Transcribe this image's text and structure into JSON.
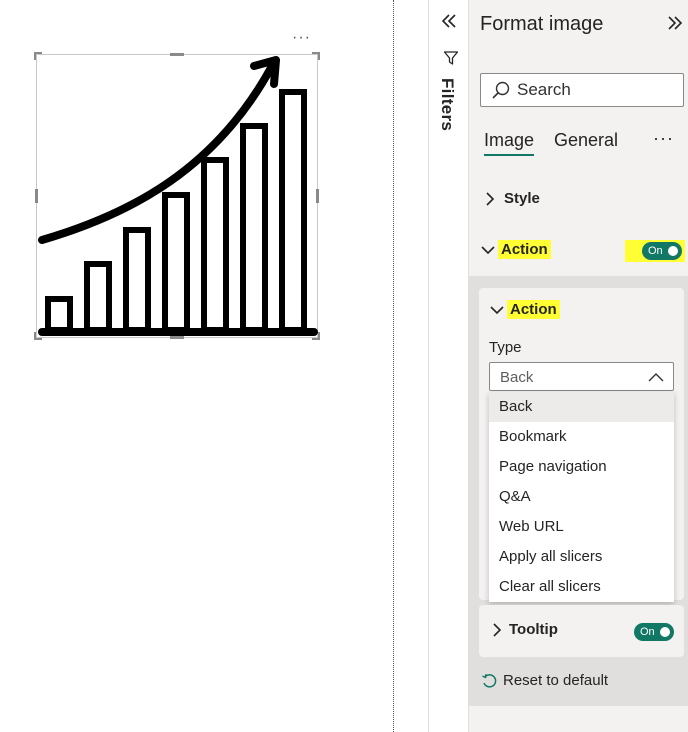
{
  "canvas": {
    "visual_more_label": "···"
  },
  "filters": {
    "label": "Filters"
  },
  "format_pane": {
    "title": "Format image",
    "search": {
      "placeholder": "Search",
      "value": ""
    },
    "tabs": [
      {
        "label": "Image",
        "active": true
      },
      {
        "label": "General",
        "active": false
      }
    ],
    "tabs_more_label": "···",
    "sections": {
      "style": {
        "label": "Style",
        "expanded": false
      },
      "action": {
        "label": "Action",
        "expanded": true,
        "toggle": {
          "label": "On",
          "on": true
        },
        "inner": {
          "label": "Action",
          "type_label": "Type",
          "type_value": "Back",
          "dropdown_open": true,
          "options": [
            "Back",
            "Bookmark",
            "Page navigation",
            "Q&A",
            "Web URL",
            "Apply all slicers",
            "Clear all slicers"
          ],
          "selected_option": "Back"
        }
      },
      "tooltip": {
        "label": "Tooltip",
        "expanded": false,
        "toggle": {
          "label": "On",
          "on": true
        }
      }
    },
    "reset_label": "Reset to default"
  },
  "colors": {
    "accent": "#117865",
    "highlight": "#ffff33",
    "pane_background": "#f3f2f1",
    "text": "#252423"
  },
  "icons": {
    "filters_collapse": "double-chevron-left-icon",
    "filters": "funnel-icon",
    "format_expand": "double-chevron-right-icon",
    "search": "search-icon",
    "section_collapsed": "chevron-right-icon",
    "section_expanded": "chevron-down-icon",
    "select": "chevron-up-icon",
    "reset": "undo-icon",
    "visual": "growth-chart-icon"
  }
}
